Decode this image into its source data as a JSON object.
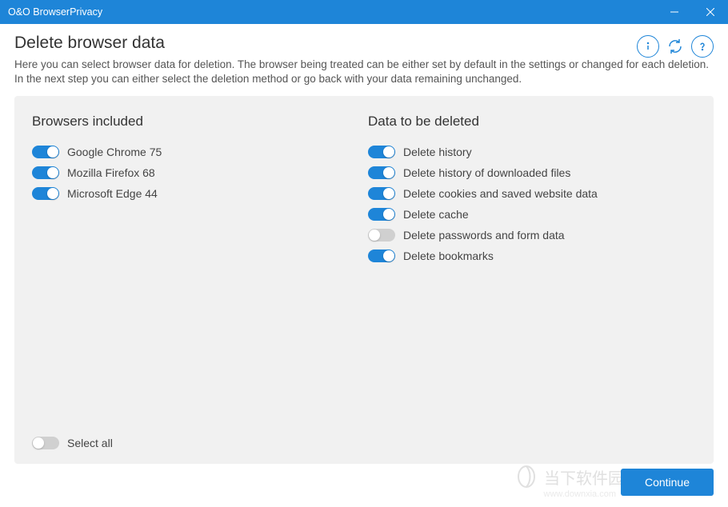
{
  "titlebar": {
    "title": "O&O BrowserPrivacy"
  },
  "header": {
    "title": "Delete browser data",
    "description": "Here you can select browser data for deletion. The browser being treated can be either set by default in the settings or changed for each deletion. In the next step you can either select the deletion method or go back with your data remaining unchanged."
  },
  "sections": {
    "browsers_title": "Browsers included",
    "data_title": "Data to be deleted"
  },
  "browsers": [
    {
      "label": "Google Chrome 75",
      "on": true
    },
    {
      "label": "Mozilla Firefox 68",
      "on": true
    },
    {
      "label": "Microsoft Edge 44",
      "on": true
    }
  ],
  "data_items": [
    {
      "label": "Delete history",
      "on": true
    },
    {
      "label": "Delete history of downloaded files",
      "on": true
    },
    {
      "label": "Delete cookies and saved website data",
      "on": true
    },
    {
      "label": "Delete cache",
      "on": true
    },
    {
      "label": "Delete passwords and form data",
      "on": false
    },
    {
      "label": "Delete bookmarks",
      "on": true
    }
  ],
  "select_all": {
    "label": "Select all",
    "on": false
  },
  "footer": {
    "continue": "Continue"
  },
  "watermark": {
    "text": "当下软件园",
    "sub": "www.downxia.com"
  }
}
